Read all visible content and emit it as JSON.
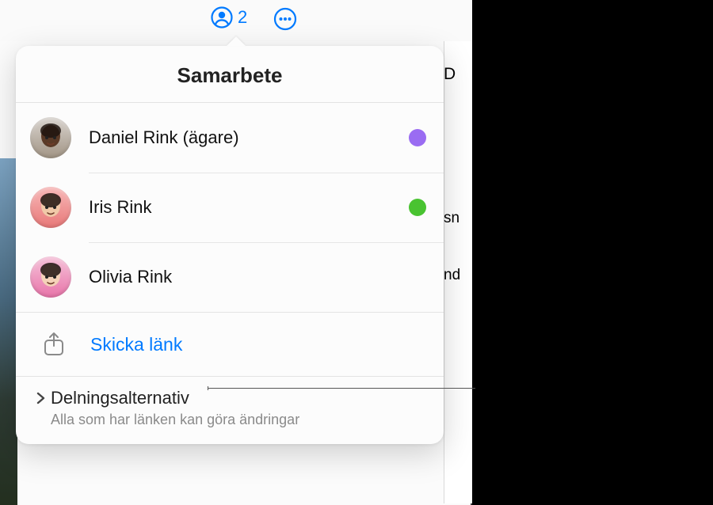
{
  "toolbar": {
    "collab_count": "2"
  },
  "popover": {
    "title": "Samarbete",
    "participants": [
      {
        "name": "Daniel Rink (ägare)",
        "avatar_bg": "linear-gradient(180deg,#d8d3ce,#a29585)",
        "skin": "#5a3a27",
        "dot": "#9a6cf2"
      },
      {
        "name": "Iris Rink",
        "avatar_bg": "linear-gradient(180deg,#f7b8b8,#e87878)",
        "skin": "#f0c9a8",
        "dot": "#49c331"
      },
      {
        "name": "Olivia Rink",
        "avatar_bg": "linear-gradient(180deg,#f5c2d9,#e874a9)",
        "skin": "#f4d2b8",
        "dot": ""
      }
    ],
    "send_link": "Skicka länk",
    "options_title": "Delningsalternativ",
    "options_sub": "Alla som har länken kan göra ändringar"
  },
  "bg": {
    "d": "D",
    "sn": "sn",
    "nd": "nd"
  }
}
